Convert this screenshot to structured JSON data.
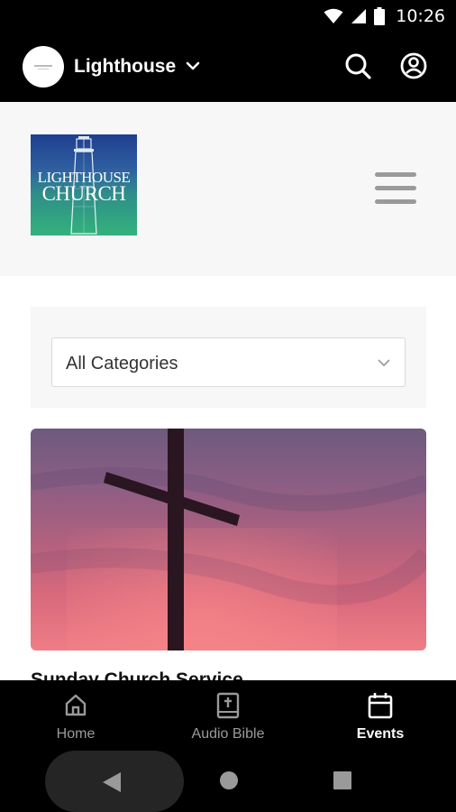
{
  "status_bar": {
    "time": "10:26",
    "icons": [
      "wifi-icon",
      "signal-icon",
      "battery-icon"
    ]
  },
  "app_header": {
    "title": "Lighthouse",
    "icons": [
      "chevron-down-icon",
      "search-icon",
      "account-icon"
    ]
  },
  "site": {
    "logo_line1": "LIGHTHOUSE",
    "logo_line2": "CHURCH",
    "menu_icon": "hamburger-menu-icon"
  },
  "filter": {
    "selected": "All Categories"
  },
  "events": [
    {
      "title": "Sunday Church Service",
      "image": "cross-at-sunset"
    }
  ],
  "bottom_nav": {
    "items": [
      {
        "label": "Home",
        "icon": "home-icon",
        "active": false
      },
      {
        "label": "Audio Bible",
        "icon": "bible-icon",
        "active": false
      },
      {
        "label": "Events",
        "icon": "calendar-icon",
        "active": true
      }
    ]
  },
  "system_nav": [
    "back-icon",
    "home-circle-icon",
    "recents-icon"
  ],
  "colors": {
    "header_bg": "#000000",
    "site_header_bg": "#f7f7f7",
    "active_nav": "#ffffff",
    "inactive_nav": "#9a9a9a"
  }
}
